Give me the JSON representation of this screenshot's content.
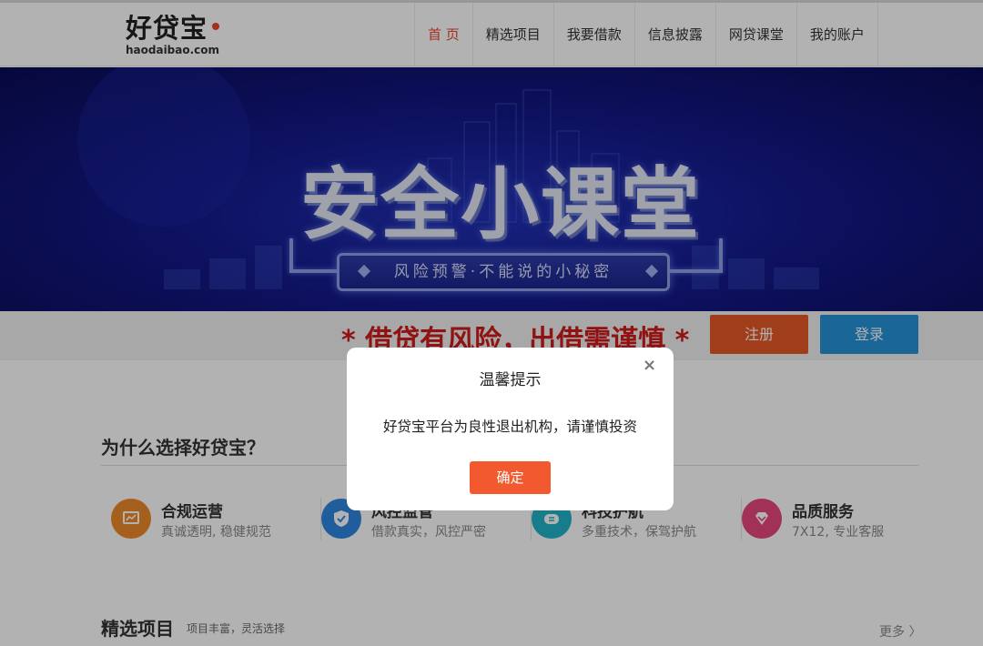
{
  "brand": {
    "logo_text": "好贷宝",
    "logo_url": "haodaibao.com",
    "accent": "#e8452a"
  },
  "nav": {
    "items": [
      {
        "label": "首 页",
        "active": true
      },
      {
        "label": "精选项目",
        "active": false
      },
      {
        "label": "我要借款",
        "active": false
      },
      {
        "label": "信息披露",
        "active": false
      },
      {
        "label": "网贷课堂",
        "active": false
      },
      {
        "label": "我的账户",
        "active": false
      }
    ]
  },
  "banner": {
    "title": "安全小课堂",
    "subtitle": "风险预警·不能说的小秘密"
  },
  "risk": {
    "warning": "* 借贷有风险，出借需谨慎 *",
    "register_label": "注册",
    "login_label": "登录",
    "register_color": "#e55a28",
    "login_color": "#2592d9"
  },
  "why": {
    "title": "为什么选择好贷宝？",
    "features": [
      {
        "title": "合规运营",
        "desc": "真诚透明, 稳健规范",
        "icon": "chart-icon",
        "color": "#ee8a2a"
      },
      {
        "title": "风控监管",
        "desc": "借款真实，风控严密",
        "icon": "shield-icon",
        "color": "#2f86e0"
      },
      {
        "title": "科技护航",
        "desc": "多重技术，保驾护航",
        "icon": "cloud-icon",
        "color": "#22b3c9"
      },
      {
        "title": "品质服务",
        "desc": "7X12, 专业客服",
        "icon": "diamond-icon",
        "color": "#e8477f"
      }
    ]
  },
  "projects": {
    "title": "精选项目",
    "subtitle": "项目丰富，灵活选择",
    "more_label": "更多 〉"
  },
  "modal": {
    "title": "温馨提示",
    "close_glyph": "×",
    "message": "好贷宝平台为良性退出机构，请谨慎投资",
    "ok_label": "确定",
    "ok_color": "#f2592e"
  }
}
